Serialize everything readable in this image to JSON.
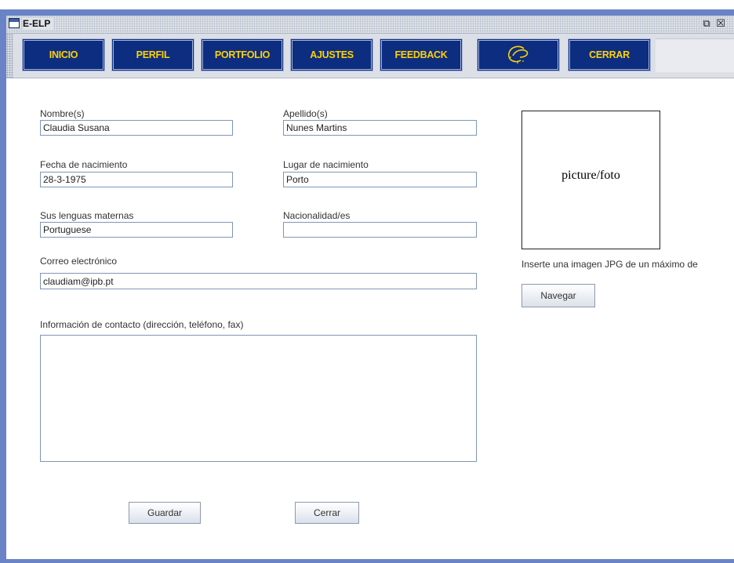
{
  "window": {
    "title": "E-ELP",
    "restore_glyph": "⧉",
    "close_glyph": "☒"
  },
  "nav": {
    "items": [
      {
        "label": "INICIO"
      },
      {
        "label": "PERFIL"
      },
      {
        "label": "PORTFOLIO"
      },
      {
        "label": "AJUSTES"
      },
      {
        "label": "FEEDBACK"
      },
      {
        "label": ""
      },
      {
        "label": "CERRAR"
      }
    ],
    "logo_icon": "council-of-europe-logo"
  },
  "form": {
    "first_name": {
      "label": "Nombre(s)",
      "value": "Claudia Susana"
    },
    "last_name": {
      "label": "Apellido(s)",
      "value": "Nunes Martins"
    },
    "birth_date": {
      "label": "Fecha de nacimiento",
      "value": "28-3-1975"
    },
    "birth_place": {
      "label": "Lugar de nacimiento",
      "value": "Porto"
    },
    "mother_tongues": {
      "label": "Sus lenguas maternas",
      "value": "Portuguese"
    },
    "nationality": {
      "label": "Nacionalidad/es",
      "value": ""
    },
    "email": {
      "label": "Correo electrónico",
      "value": "claudiam@ipb.pt"
    },
    "contact": {
      "label": "Información de contacto (dirección, teléfono, fax)",
      "value": ""
    }
  },
  "photo": {
    "placeholder": "picture/foto",
    "hint": "Inserte una imagen JPG de un máximo de",
    "browse_label": "Navegar"
  },
  "actions": {
    "save_label": "Guardar",
    "close_label": "Cerrar"
  },
  "colors": {
    "nav_background": "#0d2d80",
    "nav_text": "#ffd200",
    "frame": "#6a83c6"
  }
}
